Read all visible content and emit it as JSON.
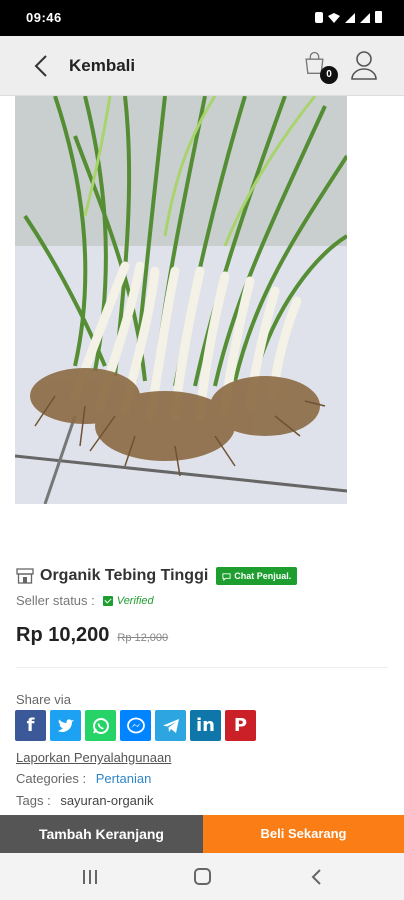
{
  "status_bar": {
    "time": "09:46"
  },
  "header": {
    "title": "Kembali",
    "cart_count": "0"
  },
  "product": {
    "shop_name": "Organik Tebing Tinggi",
    "chat_label": "Chat Penjual.",
    "seller_status_label": "Seller status :",
    "seller_status_value": "Verified",
    "price": "Rp 10,200",
    "old_price": "Rp 12,000"
  },
  "share": {
    "label": "Share via",
    "networks": [
      {
        "name": "Facebook",
        "color": "#3b5998",
        "icon": "facebook-icon"
      },
      {
        "name": "Twitter",
        "color": "#1da1f2",
        "icon": "twitter-icon"
      },
      {
        "name": "WhatsApp",
        "color": "#25d366",
        "icon": "whatsapp-icon"
      },
      {
        "name": "Messenger",
        "color": "#0084ff",
        "icon": "messenger-icon"
      },
      {
        "name": "Telegram",
        "color": "#2ca5e0",
        "icon": "telegram-icon"
      },
      {
        "name": "LinkedIn",
        "color": "#0e76a8",
        "icon": "linkedin-icon"
      },
      {
        "name": "Pinterest",
        "color": "#cb2027",
        "icon": "pinterest-icon"
      }
    ]
  },
  "details": {
    "report_link": "Laporkan Penyalahgunaan",
    "categories_label": "Categories :",
    "category": "Pertanian",
    "tags_label": "Tags :",
    "tag": "sayuran-organik"
  },
  "actions": {
    "add_to_cart": "Tambah Keranjang",
    "buy_now": "Beli Sekarang"
  },
  "colors": {
    "accent_orange": "#fa7d16",
    "verified_green": "#1e9e2f",
    "link_blue": "#2f86c9"
  }
}
